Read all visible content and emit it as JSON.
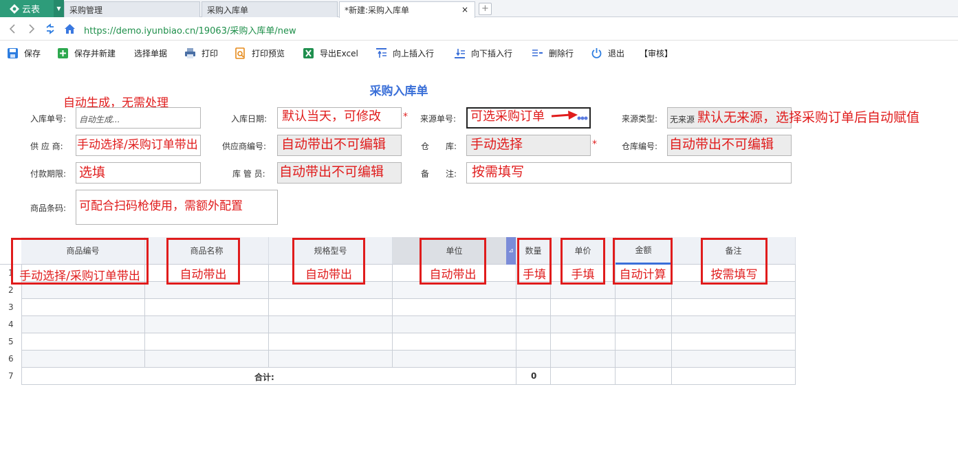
{
  "app": {
    "name": "云表"
  },
  "tabs": [
    {
      "label": "采购管理"
    },
    {
      "label": "采购入库单"
    },
    {
      "label": "*新建:采购入库单"
    }
  ],
  "tab_close": "×",
  "new_tab": "+",
  "address": {
    "url": "https://demo.iyunbiao.cn/19063/采购入库单/new"
  },
  "toolbar": {
    "save": "保存",
    "save_new": "保存并新建",
    "select_doc": "选择单据",
    "print": "打印",
    "print_preview": "打印预览",
    "export_excel": "导出Excel",
    "insert_up": "向上插入行",
    "insert_down": "向下插入行",
    "delete_row": "删除行",
    "exit": "退出",
    "audit": "【审核】"
  },
  "form": {
    "title": "采购入库单",
    "fields": {
      "doc_no": {
        "label": "入库单号:",
        "placeholder": "自动生成..."
      },
      "date": {
        "label": "入库日期:"
      },
      "source_no": {
        "label": "来源单号:"
      },
      "source_type": {
        "label": "来源类型:",
        "value": "无来源"
      },
      "supplier": {
        "label": "供 应 商:"
      },
      "supplier_code": {
        "label": "供应商编号:"
      },
      "warehouse": {
        "label": "仓　　库:"
      },
      "warehouse_code": {
        "label": "仓库编号:"
      },
      "payment_term": {
        "label": "付款期限:"
      },
      "keeper": {
        "label": "库 管 员:"
      },
      "remark": {
        "label": "备　　注:"
      },
      "barcode": {
        "label": "商品条码:"
      }
    },
    "required_mark": "*"
  },
  "annotations": {
    "auto_gen": "自动生成，无需处理",
    "date": "默认当天，可修改",
    "source_no": "可选采购订单",
    "source_type": "默认无来源，选择采购订单后自动赋值",
    "supplier": "手动选择/采购订单带出",
    "supplier_code": "自动带出不可编辑",
    "warehouse": "手动选择",
    "warehouse_code": "自动带出不可编辑",
    "payment_term": "选填",
    "keeper": "自动带出不可编辑",
    "remark": "按需填写",
    "barcode": "可配合扫码枪使用，需额外配置"
  },
  "grid": {
    "columns": [
      "商品编号",
      "商品名称",
      "规格型号",
      "单位",
      "数量",
      "单价",
      "金额",
      "备注"
    ],
    "col_annotations": [
      "手动选择/采购订单带出",
      "自动带出",
      "自动带出",
      "自动带出",
      "手填",
      "手填",
      "自动计算",
      "按需填写"
    ],
    "rows": [
      "1",
      "2",
      "3",
      "4",
      "5",
      "6",
      "7"
    ],
    "total_label": "合计:",
    "total_qty": "0"
  },
  "colors": {
    "app_green": "#2e9c7a",
    "title_blue": "#3a6fd8",
    "annotation_red": "#e01c1c",
    "url_green": "#1e8f4a"
  }
}
